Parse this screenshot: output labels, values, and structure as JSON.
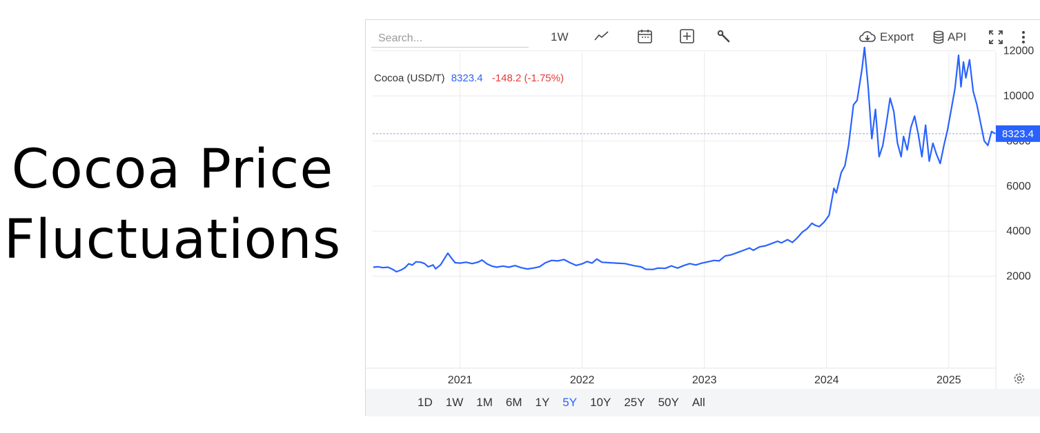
{
  "headline": {
    "line1": "Cocoa Price",
    "line2": "Fluctuations"
  },
  "toolbar": {
    "search_placeholder": "Search...",
    "interval": "1W",
    "export_label": "Export",
    "api_label": "API",
    "icons": [
      "line-chart-icon",
      "calendar-icon",
      "add-icon",
      "wrench-icon",
      "cloud-download-icon",
      "database-icon",
      "fullscreen-icon",
      "more-vertical-icon"
    ]
  },
  "legend": {
    "name": "Cocoa (USD/T)",
    "price": "8323.4",
    "change": "-148.2 (-1.75%)"
  },
  "colors": {
    "line": "#2962ff",
    "negative": "#e53935",
    "grid": "#e9e9e9",
    "axis_text": "#333333"
  },
  "periods": [
    "1D",
    "1W",
    "1M",
    "6M",
    "1Y",
    "5Y",
    "10Y",
    "25Y",
    "50Y",
    "All"
  ],
  "active_period": "5Y",
  "chart_data": {
    "type": "line",
    "title": "Cocoa (USD/T)",
    "xlabel": "",
    "ylabel": "",
    "x_ticks": [
      "2021",
      "2022",
      "2023",
      "2024",
      "2025"
    ],
    "y_ticks": [
      2000,
      4000,
      6000,
      8000,
      10000,
      12000
    ],
    "xlim": [
      2020.285,
      2025.385
    ],
    "ylim": [
      0,
      12400
    ],
    "last_price_marker": 8323.4,
    "last_price_label": "8323.4",
    "grid": true,
    "series": [
      {
        "name": "Cocoa (USD/T)",
        "points": [
          [
            2020.29,
            2400
          ],
          [
            2020.33,
            2420
          ],
          [
            2020.37,
            2380
          ],
          [
            2020.41,
            2400
          ],
          [
            2020.45,
            2300
          ],
          [
            2020.48,
            2200
          ],
          [
            2020.52,
            2280
          ],
          [
            2020.55,
            2380
          ],
          [
            2020.58,
            2550
          ],
          [
            2020.61,
            2500
          ],
          [
            2020.64,
            2640
          ],
          [
            2020.68,
            2620
          ],
          [
            2020.71,
            2560
          ],
          [
            2020.74,
            2420
          ],
          [
            2020.78,
            2500
          ],
          [
            2020.8,
            2330
          ],
          [
            2020.84,
            2500
          ],
          [
            2020.88,
            2850
          ],
          [
            2020.9,
            3020
          ],
          [
            2020.93,
            2800
          ],
          [
            2020.96,
            2600
          ],
          [
            2021.0,
            2580
          ],
          [
            2021.05,
            2620
          ],
          [
            2021.1,
            2560
          ],
          [
            2021.15,
            2630
          ],
          [
            2021.18,
            2720
          ],
          [
            2021.22,
            2550
          ],
          [
            2021.26,
            2450
          ],
          [
            2021.3,
            2400
          ],
          [
            2021.35,
            2450
          ],
          [
            2021.4,
            2400
          ],
          [
            2021.45,
            2470
          ],
          [
            2021.5,
            2380
          ],
          [
            2021.55,
            2320
          ],
          [
            2021.6,
            2360
          ],
          [
            2021.65,
            2420
          ],
          [
            2021.7,
            2600
          ],
          [
            2021.75,
            2700
          ],
          [
            2021.8,
            2680
          ],
          [
            2021.85,
            2740
          ],
          [
            2021.9,
            2600
          ],
          [
            2021.95,
            2480
          ],
          [
            2022.0,
            2550
          ],
          [
            2022.04,
            2650
          ],
          [
            2022.08,
            2580
          ],
          [
            2022.12,
            2760
          ],
          [
            2022.16,
            2620
          ],
          [
            2022.22,
            2600
          ],
          [
            2022.28,
            2580
          ],
          [
            2022.35,
            2560
          ],
          [
            2022.42,
            2470
          ],
          [
            2022.48,
            2420
          ],
          [
            2022.52,
            2310
          ],
          [
            2022.58,
            2300
          ],
          [
            2022.62,
            2360
          ],
          [
            2022.68,
            2350
          ],
          [
            2022.73,
            2460
          ],
          [
            2022.78,
            2360
          ],
          [
            2022.83,
            2470
          ],
          [
            2022.88,
            2560
          ],
          [
            2022.93,
            2500
          ],
          [
            2022.98,
            2580
          ],
          [
            2023.03,
            2640
          ],
          [
            2023.08,
            2700
          ],
          [
            2023.12,
            2680
          ],
          [
            2023.17,
            2900
          ],
          [
            2023.22,
            2950
          ],
          [
            2023.27,
            3050
          ],
          [
            2023.32,
            3150
          ],
          [
            2023.37,
            3250
          ],
          [
            2023.4,
            3150
          ],
          [
            2023.45,
            3300
          ],
          [
            2023.5,
            3350
          ],
          [
            2023.55,
            3450
          ],
          [
            2023.6,
            3550
          ],
          [
            2023.63,
            3480
          ],
          [
            2023.68,
            3620
          ],
          [
            2023.72,
            3500
          ],
          [
            2023.76,
            3700
          ],
          [
            2023.8,
            3950
          ],
          [
            2023.84,
            4100
          ],
          [
            2023.88,
            4350
          ],
          [
            2023.91,
            4250
          ],
          [
            2023.94,
            4200
          ],
          [
            2023.98,
            4400
          ],
          [
            2024.02,
            4700
          ],
          [
            2024.06,
            5900
          ],
          [
            2024.08,
            5700
          ],
          [
            2024.12,
            6600
          ],
          [
            2024.15,
            6900
          ],
          [
            2024.18,
            7800
          ],
          [
            2024.22,
            9600
          ],
          [
            2024.25,
            9800
          ],
          [
            2024.29,
            11200
          ],
          [
            2024.31,
            12150
          ],
          [
            2024.34,
            10400
          ],
          [
            2024.37,
            8100
          ],
          [
            2024.4,
            9400
          ],
          [
            2024.43,
            7300
          ],
          [
            2024.46,
            7800
          ],
          [
            2024.49,
            8800
          ],
          [
            2024.52,
            9900
          ],
          [
            2024.55,
            9300
          ],
          [
            2024.58,
            7900
          ],
          [
            2024.61,
            7300
          ],
          [
            2024.63,
            8200
          ],
          [
            2024.66,
            7600
          ],
          [
            2024.69,
            8600
          ],
          [
            2024.72,
            9100
          ],
          [
            2024.75,
            8300
          ],
          [
            2024.78,
            7300
          ],
          [
            2024.81,
            8700
          ],
          [
            2024.84,
            7100
          ],
          [
            2024.87,
            7900
          ],
          [
            2024.9,
            7400
          ],
          [
            2024.93,
            7000
          ],
          [
            2024.96,
            7800
          ],
          [
            2024.99,
            8500
          ],
          [
            2025.02,
            9400
          ],
          [
            2025.05,
            10300
          ],
          [
            2025.08,
            11800
          ],
          [
            2025.1,
            10400
          ],
          [
            2025.12,
            11500
          ],
          [
            2025.14,
            10800
          ],
          [
            2025.17,
            11600
          ],
          [
            2025.2,
            10200
          ],
          [
            2025.23,
            9600
          ],
          [
            2025.26,
            8800
          ],
          [
            2025.29,
            8000
          ],
          [
            2025.32,
            7800
          ],
          [
            2025.35,
            8420
          ],
          [
            2025.38,
            8320
          ]
        ]
      }
    ]
  }
}
